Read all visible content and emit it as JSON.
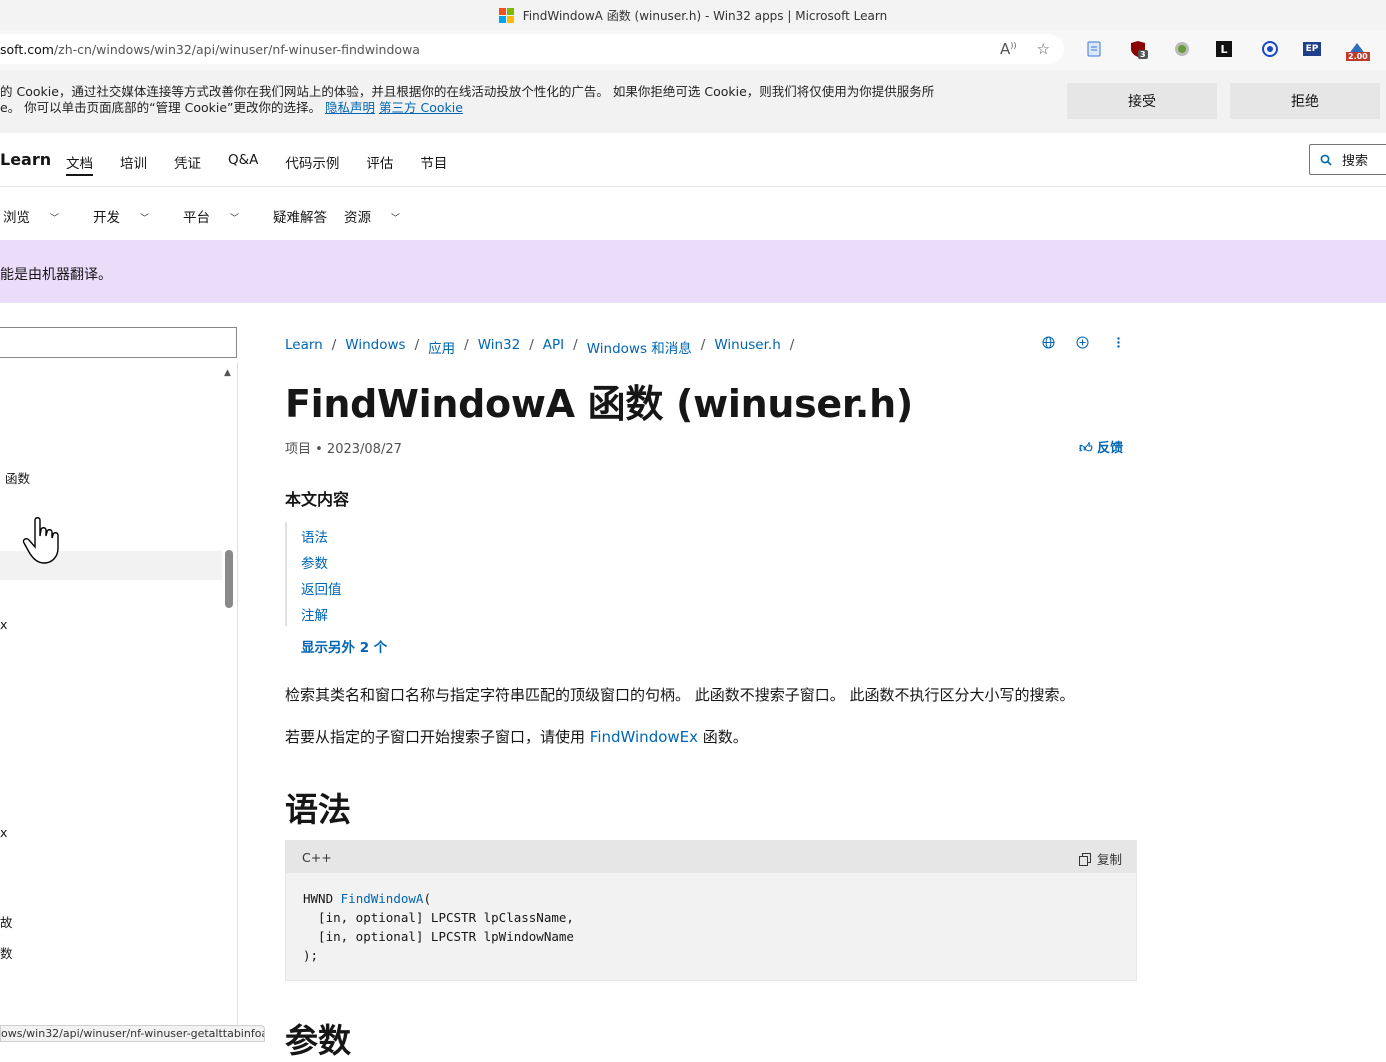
{
  "window": {
    "title": "FindWindowA 函数 (winuser.h) - Win32 apps | Microsoft Learn"
  },
  "addressbar": {
    "host": "soft.com",
    "path": "/zh-cn/windows/win32/api/winuser/nf-winuser-findwindowa",
    "extension_badges": {
      "shield_count": "3",
      "lightning_value": "2.00"
    }
  },
  "cookie_banner": {
    "line1": "的 Cookie，通过社交媒体连接等方式改善你在我们网站上的体验，并且根据你的在线活动投放个性化的广告。 如果你拒绝可选 Cookie，则我们将仅使用为你提供服务所",
    "line2_prefix": "e。 你可以单击页面底部的“管理 Cookie”更改你的选择。",
    "privacy_link": "隐私声明",
    "third_party_link": "第三方 Cookie",
    "accept_label": "接受",
    "reject_label": "拒绝"
  },
  "header": {
    "brand": "Learn",
    "nav": [
      "文档",
      "培训",
      "凭证",
      "Q&A",
      "代码示例",
      "评估",
      "节目"
    ],
    "search_label": "搜索"
  },
  "subnav": {
    "items": [
      "浏览",
      "开发",
      "平台",
      "疑难解答",
      "资源"
    ]
  },
  "mt_banner": {
    "text": "能是由机器翻译。"
  },
  "toc": {
    "items": [
      "函数",
      "x",
      "x",
      "故",
      "数"
    ]
  },
  "breadcrumb": [
    "Learn",
    "Windows",
    "应用",
    "Win32",
    "API",
    "Windows 和消息",
    "Winuser.h"
  ],
  "article": {
    "title": "FindWindowA 函数 (winuser.h)",
    "meta": "项目 • 2023/08/27",
    "feedback": "反馈",
    "in_this_article": "本文内容",
    "toc_links": [
      "语法",
      "参数",
      "返回值",
      "注解"
    ],
    "show_more": "显示另外 2 个",
    "para1": "检索其类名和窗口名称与指定字符串匹配的顶级窗口的句柄。 此函数不搜索子窗口。 此函数不执行区分大小写的搜索。",
    "para2_prefix": "若要从指定的子窗口开始搜索子窗口，请使用 ",
    "para2_link": "FindWindowEx",
    "para2_suffix": " 函数。",
    "syntax_heading": "语法",
    "params_heading": "参数",
    "code": {
      "language": "C++",
      "copy_label": "复制",
      "line1_type": "HWND ",
      "line1_fn": "FindWindowA",
      "line1_rest": "(",
      "line2": "  [in, optional] LPCSTR lpClassName,",
      "line3": "  [in, optional] LPCSTR lpWindowName",
      "line4": ");"
    }
  },
  "statusbar": {
    "url": "ows/win32/api/winuser/nf-winuser-getalttabinfoa"
  },
  "colors": {
    "link": "#0065b3",
    "mt_banner": "#ebdcfa",
    "cookie_bg": "#f2f2f2"
  }
}
